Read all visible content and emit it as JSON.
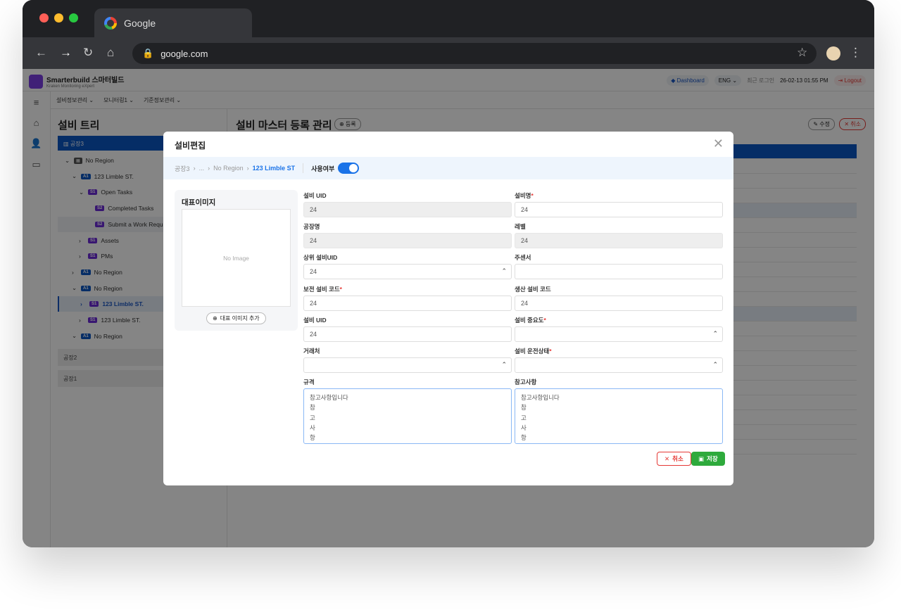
{
  "browser": {
    "tab_title": "Google",
    "url": "google.com"
  },
  "app": {
    "brand": "Smarterbuild 스마터빌드",
    "subtitle": "Kraken Monitoring eXpert",
    "dashboard": "Dashboard",
    "lang": "ENG",
    "last_login_label": "최근 로그인",
    "last_login": "26-02-13 01:55 PM",
    "logout": "Logout",
    "menu": [
      "설비정보관리",
      "모니터링1",
      "기준정보관리"
    ]
  },
  "tree": {
    "title": "설비 트리",
    "selected_factory": "공장3",
    "items": [
      {
        "badge": "",
        "label": "No Region",
        "arrow": "⌄"
      },
      {
        "badge": "A1",
        "label": "123 Limble ST.",
        "arrow": "⌄"
      },
      {
        "badge": "S1",
        "label": "Open Tasks",
        "arrow": "⌄"
      },
      {
        "badge": "S2",
        "label": "Completed Tasks",
        "arrow": ""
      },
      {
        "badge": "S2",
        "label": "Submit a Work Request",
        "arrow": ""
      },
      {
        "badge": "S1",
        "label": "Assets",
        "arrow": "›"
      },
      {
        "badge": "S1",
        "label": "PMs",
        "arrow": "›"
      },
      {
        "badge": "A1",
        "label": "No Region",
        "arrow": "›"
      },
      {
        "badge": "A1",
        "label": "No Region",
        "arrow": "⌄"
      },
      {
        "badge": "S1",
        "label": "123 Limble ST.",
        "arrow": "›"
      },
      {
        "badge": "S1",
        "label": "123 Limble ST.",
        "arrow": "›"
      },
      {
        "badge": "A1",
        "label": "No Region",
        "arrow": "⌄"
      }
    ],
    "factories": [
      "공장2",
      "공장1"
    ]
  },
  "main": {
    "title": "설비 마스터 등록 관리",
    "register": "등록",
    "edit": "수정",
    "cancel": "취소"
  },
  "modal": {
    "title": "설비편집",
    "breadcrumb": [
      "공장3",
      "...",
      "No Region",
      "123 Limble ST"
    ],
    "use_label": "사용여부",
    "use_enabled": true,
    "image_title": "대표이미지",
    "no_image": "No Image",
    "add_image": "대표 이미지 추가",
    "fields": {
      "uid": {
        "label": "설비 UID",
        "value": "24"
      },
      "name": {
        "label": "설비명",
        "value": "24"
      },
      "factory": {
        "label": "공장명",
        "value": "24"
      },
      "level": {
        "label": "레벨",
        "value": "24"
      },
      "parent_uid": {
        "label": "상위 설비UID",
        "value": "24"
      },
      "main_sensor": {
        "label": "주센서",
        "value": ""
      },
      "maint_code": {
        "label": "보전 설비 코드",
        "value": "24"
      },
      "prod_code": {
        "label": "생산 설비 코드",
        "value": "24"
      },
      "uid2": {
        "label": "설비 UID",
        "value": "24"
      },
      "importance": {
        "label": "설비 중요도",
        "value": ""
      },
      "vendor": {
        "label": "거래처",
        "value": ""
      },
      "op_status": {
        "label": "설비 운전상태",
        "value": ""
      },
      "spec": {
        "label": "규격",
        "value": "참고사항입니다\n참\n고\n사\n항"
      },
      "notes": {
        "label": "참고사항",
        "value": "참고사항입니다\n참\n고\n사\n항"
      }
    },
    "cancel": "취소",
    "save": "저장"
  }
}
